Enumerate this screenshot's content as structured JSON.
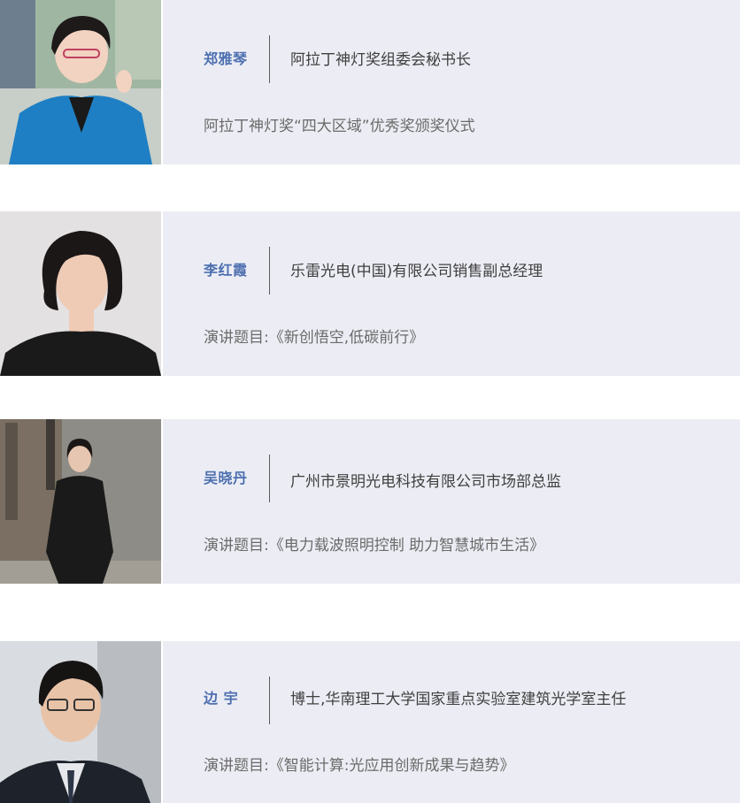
{
  "speakers": [
    {
      "name": "郑雅琴",
      "title": "阿拉丁神灯奖组委会秘书长",
      "topic": "阿拉丁神灯奖“四大区域”优秀奖颁奖仪式"
    },
    {
      "name": "李红霞",
      "title": "乐雷光电(中国)有限公司销售副总经理",
      "topic": "演讲题目:《新创悟空,低碳前行》"
    },
    {
      "name": "吴晓丹",
      "title": "广州市景明光电科技有限公司市场部总监",
      "topic": "演讲题目:《电力载波照明控制 助力智慧城市生活》"
    },
    {
      "name": "边 宇",
      "title": "博士,华南理工大学国家重点实验室建筑光学室主任",
      "topic": "演讲题目:《智能计算:光应用创新成果与趋势》"
    }
  ],
  "colors": {
    "name_accent": "#4d6fb0",
    "card_background": "#ecedf4",
    "title_text": "#3f3f3f",
    "topic_text": "#6a6a6a"
  }
}
